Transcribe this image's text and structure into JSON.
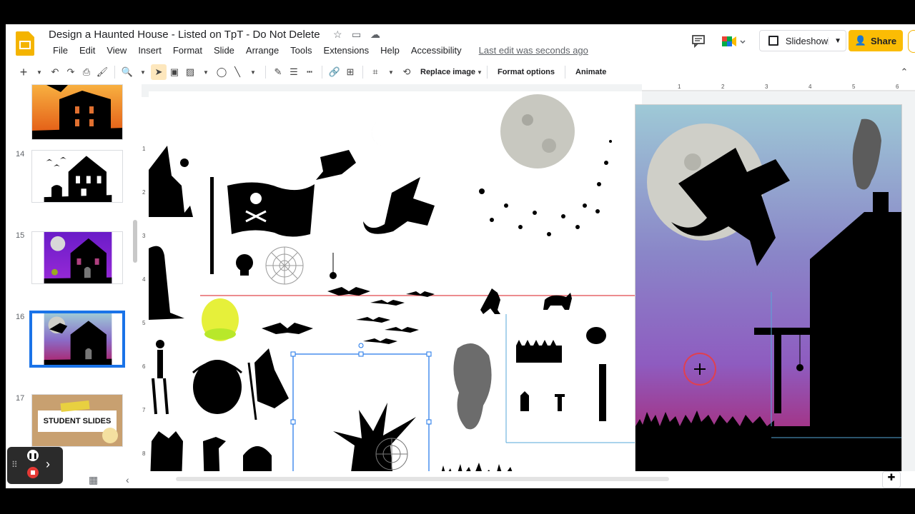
{
  "app": {
    "doc_title": "Design a Haunted House - Listed on TpT - Do Not Delete",
    "menu": [
      "File",
      "Edit",
      "View",
      "Insert",
      "Format",
      "Slide",
      "Arrange",
      "Tools",
      "Extensions",
      "Help",
      "Accessibility"
    ],
    "last_edit": "Last edit was seconds ago",
    "slideshow_label": "Slideshow",
    "share_label": "Share"
  },
  "toolbar": {
    "replace_image": "Replace image",
    "format_options": "Format options",
    "animate": "Animate"
  },
  "filmstrip": {
    "slides": [
      {
        "num": "",
        "caption": ""
      },
      {
        "num": "14",
        "caption": ""
      },
      {
        "num": "15",
        "caption": ""
      },
      {
        "num": "16",
        "caption": "",
        "selected": true
      },
      {
        "num": "17",
        "caption": "STUDENT SLIDES"
      }
    ]
  },
  "ruler": {
    "top_ticks": [
      "1",
      "2",
      "3",
      "4",
      "5",
      "6"
    ],
    "left_ticks": [
      "1",
      "2",
      "3",
      "4",
      "5",
      "6",
      "7",
      "8"
    ]
  },
  "colors": {
    "accent": "#1a73e8",
    "share": "#fbbc04",
    "guide": "#e0474c"
  }
}
